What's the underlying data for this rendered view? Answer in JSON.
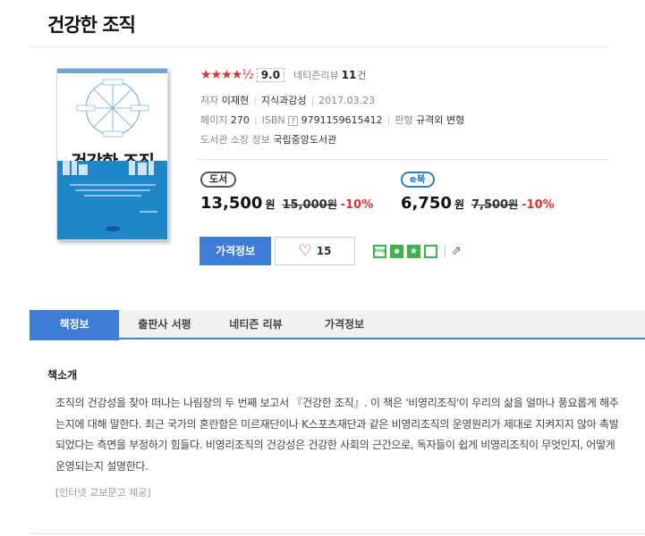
{
  "book": {
    "title": "건강한 조직",
    "cover": {
      "title": "건강한 조직",
      "accent": "#1f86c8"
    }
  },
  "rating": {
    "stars": "★★★★½",
    "score": "9.0",
    "review_label": "네티즌리뷰",
    "review_count": "11",
    "review_unit": "건"
  },
  "meta": {
    "author_label": "저자",
    "author": "이재현",
    "publisher": "지식과감성",
    "date": "2017.03.23",
    "pages_label": "페이지",
    "pages": "270",
    "isbn_label": "ISBN",
    "isbn_help": "?",
    "isbn": "9791159615412",
    "format_label": "판형",
    "format": "규격외 변형",
    "library_label": "도서관 소장 정보",
    "library": "국립중앙도서관"
  },
  "prices": {
    "print": {
      "badge": "도서",
      "sale": "13,500",
      "won": "원",
      "original": "15,000",
      "original_won": "원",
      "discount": "-10%"
    },
    "ebook": {
      "badge": "e북",
      "sale": "6,750",
      "won": "원",
      "original": "7,500",
      "original_won": "원",
      "discount": "-10%"
    }
  },
  "actions": {
    "price_info": "가격정보",
    "like_count": "15",
    "share_icons": [
      "blog-icon",
      "band-icon",
      "bookmark-star-icon",
      "note-icon",
      "share-out-icon"
    ],
    "blog_text": "blog"
  },
  "tabs": [
    {
      "label": "책정보",
      "active": true
    },
    {
      "label": "출판사 서평",
      "active": false
    },
    {
      "label": "네티즌 리뷰",
      "active": false
    },
    {
      "label": "가격정보",
      "active": false
    }
  ],
  "intro": {
    "heading": "책소개",
    "body": "조직의 건강성을 찾아 떠나는 나림장의 두 번째 보고서 『건강한 조직』. 이 책은 '비영리조직'이 우리의 삶을 얼마나 풍요롭게 해주는지에 대해 말한다. 최근 국가의 혼란함은 미르재단이나 K스포츠재단과 같은 비영리조직의 운영원리가 제대로 지켜지지 않아 촉발되었다는 측면을 부정하기 힘들다. 비영리조직의 건강성은 건강한 사회의 근간으로, 독자들이 쉽게 비영리조직이 무엇인지, 어떻게 운영되는지 설명한다.",
    "source": "[인터넷 교보문고 제공]"
  },
  "colors": {
    "accent": "#3d7dd6",
    "discount": "#e62e2e",
    "star": "#e62e2e"
  }
}
